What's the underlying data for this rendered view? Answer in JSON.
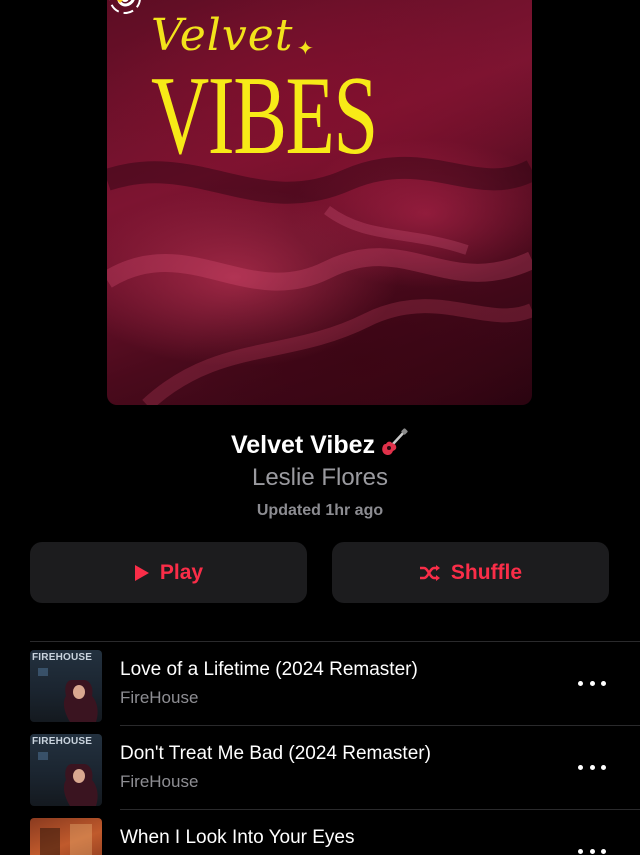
{
  "artwork": {
    "script_text": "Velvet",
    "main_text": "VIBES",
    "sparkle": "✦",
    "colors": {
      "text": "#f2e31b",
      "velvet": "#7d1431"
    }
  },
  "playlist": {
    "title": "Velvet Vibez",
    "title_emoji_icon": "guitar-icon",
    "curator": "Leslie Flores",
    "updated": "Updated 1hr ago"
  },
  "actions": {
    "play_label": "Play",
    "shuffle_label": "Shuffle",
    "accent_color": "#fa2d48"
  },
  "tracks": [
    {
      "title": "Love of a Lifetime (2024 Remaster)",
      "artist": "FireHouse",
      "art_text": "FIREHOUSE"
    },
    {
      "title": "Don't Treat Me Bad (2024 Remaster)",
      "artist": "FireHouse",
      "art_text": "FIREHOUSE"
    },
    {
      "title": "When I Look Into Your Eyes",
      "artist": "",
      "art_text": ""
    }
  ]
}
